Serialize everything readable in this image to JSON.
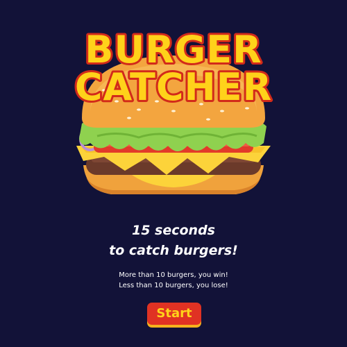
{
  "game": {
    "title_line_1": "BURGER",
    "title_line_2": "CATCHER",
    "headline_line_1": "15 seconds",
    "headline_line_2": "to catch burgers!",
    "rule_win": "More than 10 burgers, you win!",
    "rule_lose": "Less than 10 burgers, you lose!",
    "start_label": "Start"
  },
  "colors": {
    "background": "#121238",
    "title_fill": "#ffd21a",
    "title_outline": "#d22a1a",
    "button": "#e03223",
    "button_text": "#ffd21a",
    "button_shadow": "#f4b21d"
  },
  "icons": {
    "hero": "burger-illustration"
  }
}
